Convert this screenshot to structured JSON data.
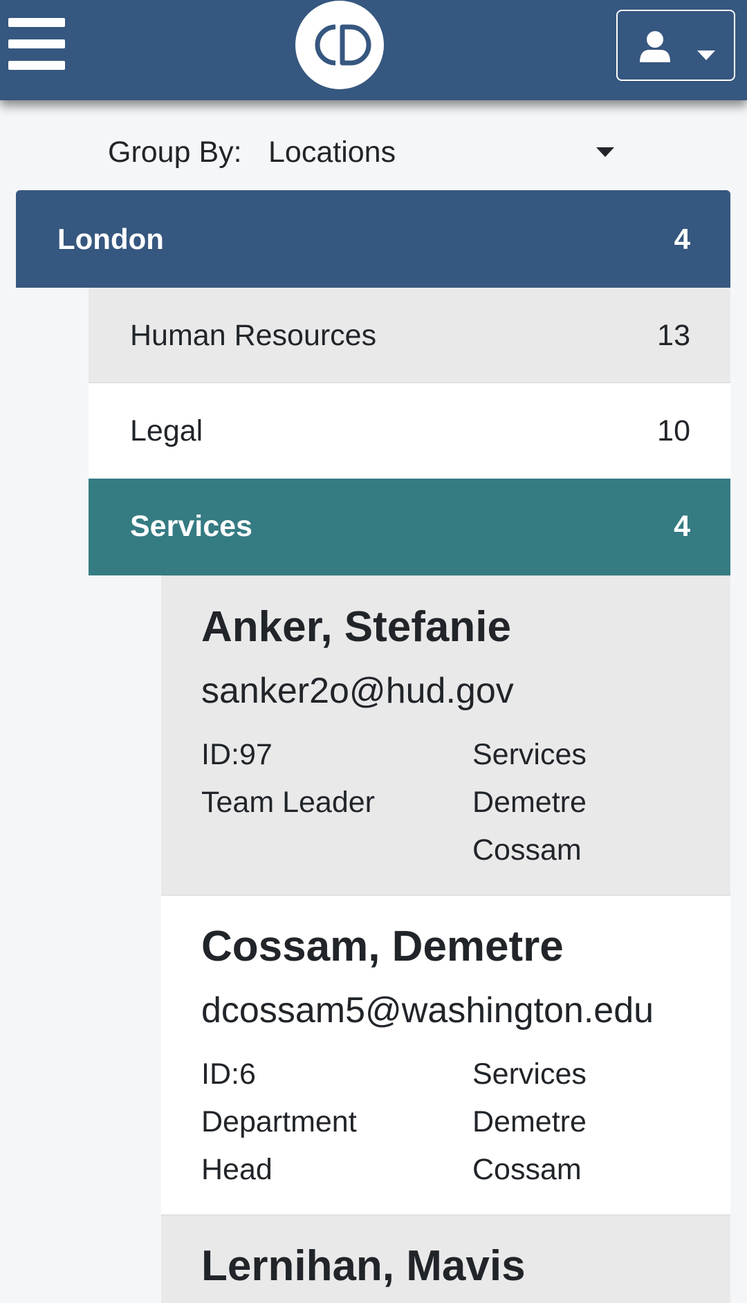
{
  "header": {
    "logo_text": "CD",
    "menu_icon": "hamburger-icon",
    "user_icon": "user-icon",
    "user_caret_icon": "caret-down-icon"
  },
  "group_by": {
    "label": "Group By:",
    "selected": "Locations"
  },
  "location": {
    "name": "London",
    "count": "4"
  },
  "departments": [
    {
      "name": "Human Resources",
      "count": "13"
    },
    {
      "name": "Legal",
      "count": "10"
    },
    {
      "name": "Services",
      "count": "4"
    }
  ],
  "employees": [
    {
      "name": "Anker, Stefanie",
      "email": "sanker2o@hud.gov",
      "id": "ID:97",
      "role_lines": [
        "Team Leader"
      ],
      "department": "Services",
      "manager_lines": [
        "Demetre",
        "Cossam"
      ]
    },
    {
      "name": "Cossam, Demetre",
      "email": "dcossam5@washington.edu",
      "id": "ID:6",
      "role_lines": [
        "Department",
        "Head"
      ],
      "department": "Services",
      "manager_lines": [
        "Demetre",
        "Cossam"
      ]
    },
    {
      "name": "Lernihan, Mavis"
    }
  ],
  "colors": {
    "header_bg": "#36577f",
    "location_bg": "#36577f",
    "selected_dept_bg": "#357b82",
    "row_alt_bg": "#e9e9ea"
  }
}
